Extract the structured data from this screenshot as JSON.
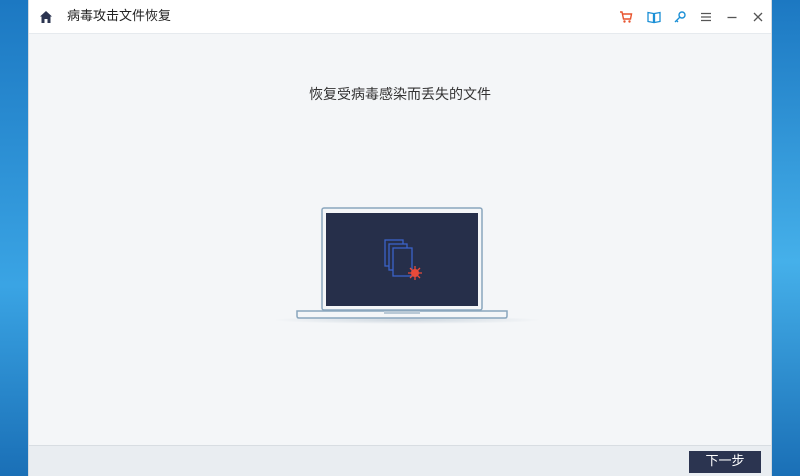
{
  "window": {
    "title": "病毒攻击文件恢复"
  },
  "icons": {
    "home": "home-icon",
    "cart": "cart-icon",
    "book": "book-icon",
    "key": "key-icon",
    "menu": "menu-icon",
    "minimize": "minimize-icon",
    "close": "close-icon"
  },
  "colors": {
    "cart": "#e8532d",
    "toolbar_icon": "#1a8fd6",
    "screen": "#262f4a",
    "virus": "#e84a3a",
    "button": "#2b3450"
  },
  "main": {
    "heading": "恢复受病毒感染而丢失的文件"
  },
  "footer": {
    "next_label": "下一步"
  }
}
